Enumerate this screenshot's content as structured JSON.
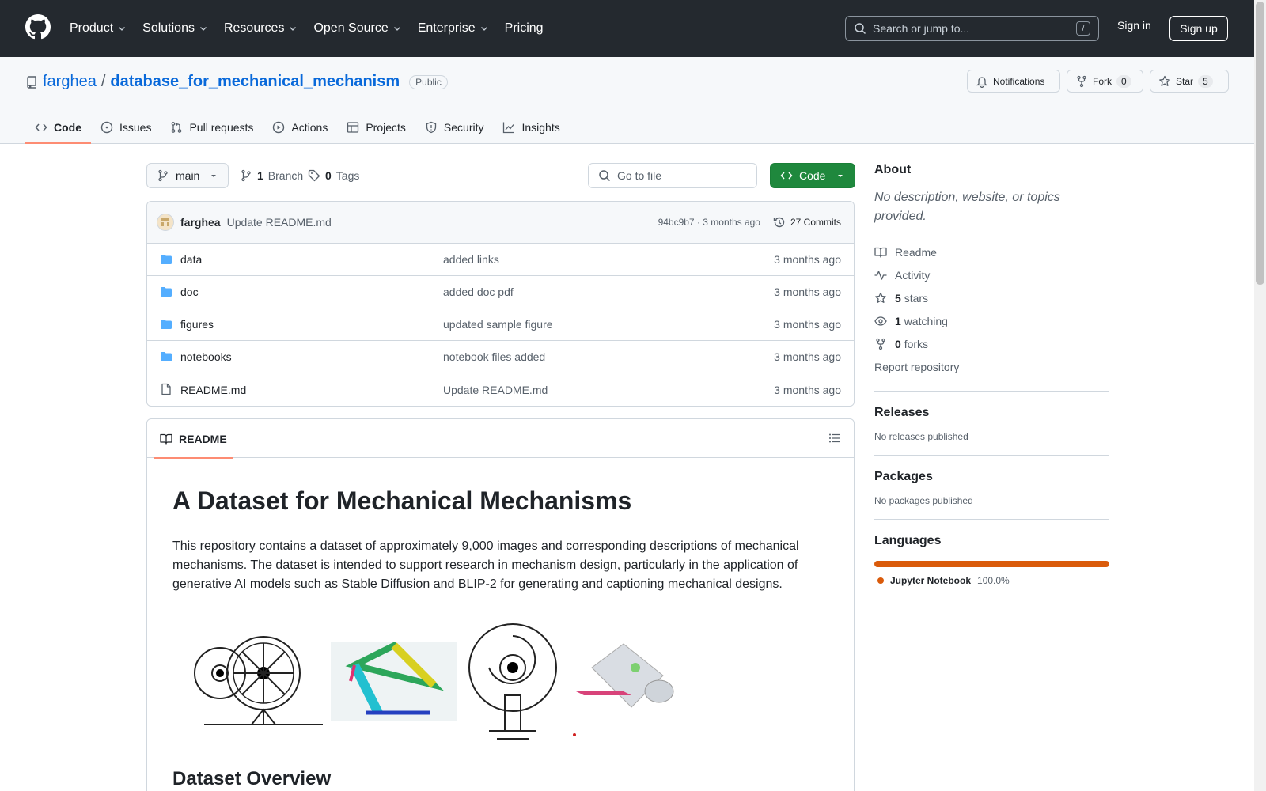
{
  "nav": {
    "menu": [
      {
        "label": "Product"
      },
      {
        "label": "Solutions"
      },
      {
        "label": "Resources"
      },
      {
        "label": "Open Source"
      },
      {
        "label": "Enterprise"
      },
      {
        "label": "Pricing"
      }
    ],
    "search_placeholder": "Search or jump to...",
    "search_shortcut": "/",
    "sign_in": "Sign in",
    "sign_up": "Sign up"
  },
  "repo": {
    "owner": "farghea",
    "separator": "/",
    "name": "database_for_mechanical_mechanism",
    "visibility": "Public",
    "notifications_label": "Notifications",
    "fork_label": "Fork",
    "fork_count": "0",
    "star_label": "Star",
    "star_count": "5"
  },
  "tabs": [
    {
      "label": "Code",
      "icon": "code-icon"
    },
    {
      "label": "Issues",
      "icon": "issue-icon"
    },
    {
      "label": "Pull requests",
      "icon": "pull-request-icon"
    },
    {
      "label": "Actions",
      "icon": "play-icon"
    },
    {
      "label": "Projects",
      "icon": "table-icon"
    },
    {
      "label": "Security",
      "icon": "shield-icon"
    },
    {
      "label": "Insights",
      "icon": "graph-icon"
    }
  ],
  "toolbar": {
    "branch": "main",
    "branch_count": "1",
    "branch_label": "Branch",
    "tag_count": "0",
    "tag_label": "Tags",
    "goto_placeholder": "Go to file",
    "code_label": "Code"
  },
  "commit": {
    "author": "farghea",
    "message": "Update README.md",
    "meta": "94bc9b7 · 3 months ago",
    "commits_label": "27 Commits"
  },
  "files": [
    {
      "name": "data",
      "type": "folder",
      "message": "added links",
      "time": "3 months ago"
    },
    {
      "name": "doc",
      "type": "folder",
      "message": "added doc pdf",
      "time": "3 months ago"
    },
    {
      "name": "figures",
      "type": "folder",
      "message": "updated sample figure",
      "time": "3 months ago"
    },
    {
      "name": "notebooks",
      "type": "folder",
      "message": "notebook files added",
      "time": "3 months ago"
    },
    {
      "name": "README.md",
      "type": "file",
      "message": "Update README.md",
      "time": "3 months ago"
    }
  ],
  "readme": {
    "tab_label": "README",
    "title": "A Dataset for Mechanical Mechanisms",
    "paragraph": "This repository contains a dataset of approximately 9,000 images and corresponding descriptions of mechanical mechanisms. The dataset is intended to support research in mechanism design, particularly in the application of generative AI models such as Stable Diffusion and BLIP-2 for generating and captioning mechanical designs.",
    "next_heading": "Dataset Overview"
  },
  "about": {
    "heading": "About",
    "description": "No description, website, or topics provided.",
    "readme": "Readme",
    "activity": "Activity",
    "stars_count": "5",
    "stars_label": "stars",
    "watching_count": "1",
    "watching_label": "watching",
    "forks_count": "0",
    "forks_label": "forks",
    "report": "Report repository"
  },
  "releases": {
    "heading": "Releases",
    "text": "No releases published"
  },
  "packages": {
    "heading": "Packages",
    "text": "No packages published"
  },
  "languages": {
    "heading": "Languages",
    "items": [
      {
        "name": "Jupyter Notebook",
        "percent": "100.0%",
        "color": "#da5b0b"
      }
    ]
  },
  "colors": {
    "link": "#0969da",
    "primary": "#1f883d",
    "accent": "#fd8c73",
    "folder": "#54aeff"
  }
}
